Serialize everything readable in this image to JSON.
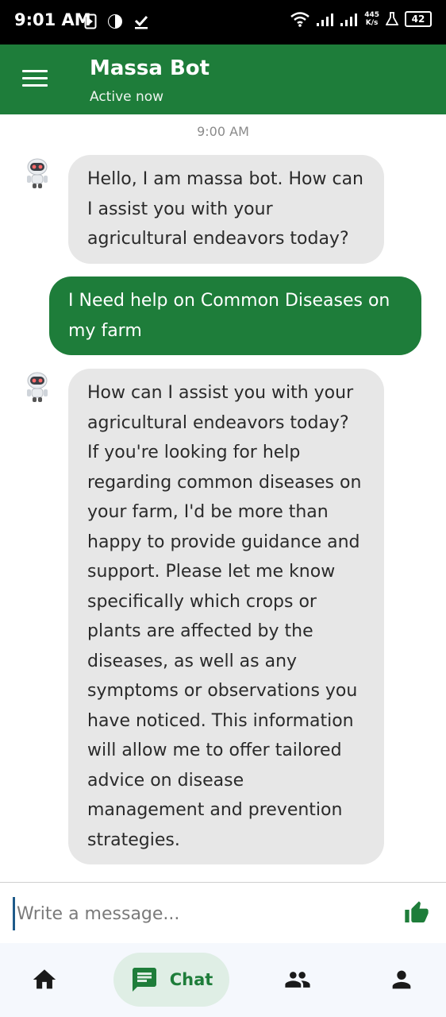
{
  "status_bar": {
    "time": "9:01 AM",
    "net_speed_value": "445",
    "net_speed_unit": "K/s",
    "battery": "42"
  },
  "header": {
    "title": "Massa Bot",
    "subtitle": "Active now"
  },
  "chat": {
    "timestamp": "9:00 AM",
    "messages": [
      {
        "sender": "bot",
        "text": "Hello, I am massa bot. How can I assist you with your agricultural endeavors today?"
      },
      {
        "sender": "user",
        "text": "I Need help on Common Diseases on my farm"
      },
      {
        "sender": "bot",
        "text": "How can I assist you with your agricultural endeavors today? If you're looking for help regarding common diseases on your farm, I'd be more than happy to provide guidance and support. Please let me know specifically which crops or plants are affected by the diseases, as well as any symptoms or observations you have noticed. This information will allow me to offer tailored advice on disease management and prevention strategies."
      }
    ]
  },
  "input": {
    "placeholder": "Write a message...",
    "value": ""
  },
  "bottom_nav": {
    "items": [
      {
        "icon": "home-icon",
        "label": ""
      },
      {
        "icon": "chat-icon",
        "label": "Chat",
        "active": true
      },
      {
        "icon": "people-icon",
        "label": ""
      },
      {
        "icon": "person-icon",
        "label": ""
      }
    ]
  },
  "colors": {
    "primary": "#1e7d3a",
    "bot_bubble": "#e7e7e7",
    "nav_background": "#f5f8fd",
    "active_pill": "#dfeee5"
  }
}
